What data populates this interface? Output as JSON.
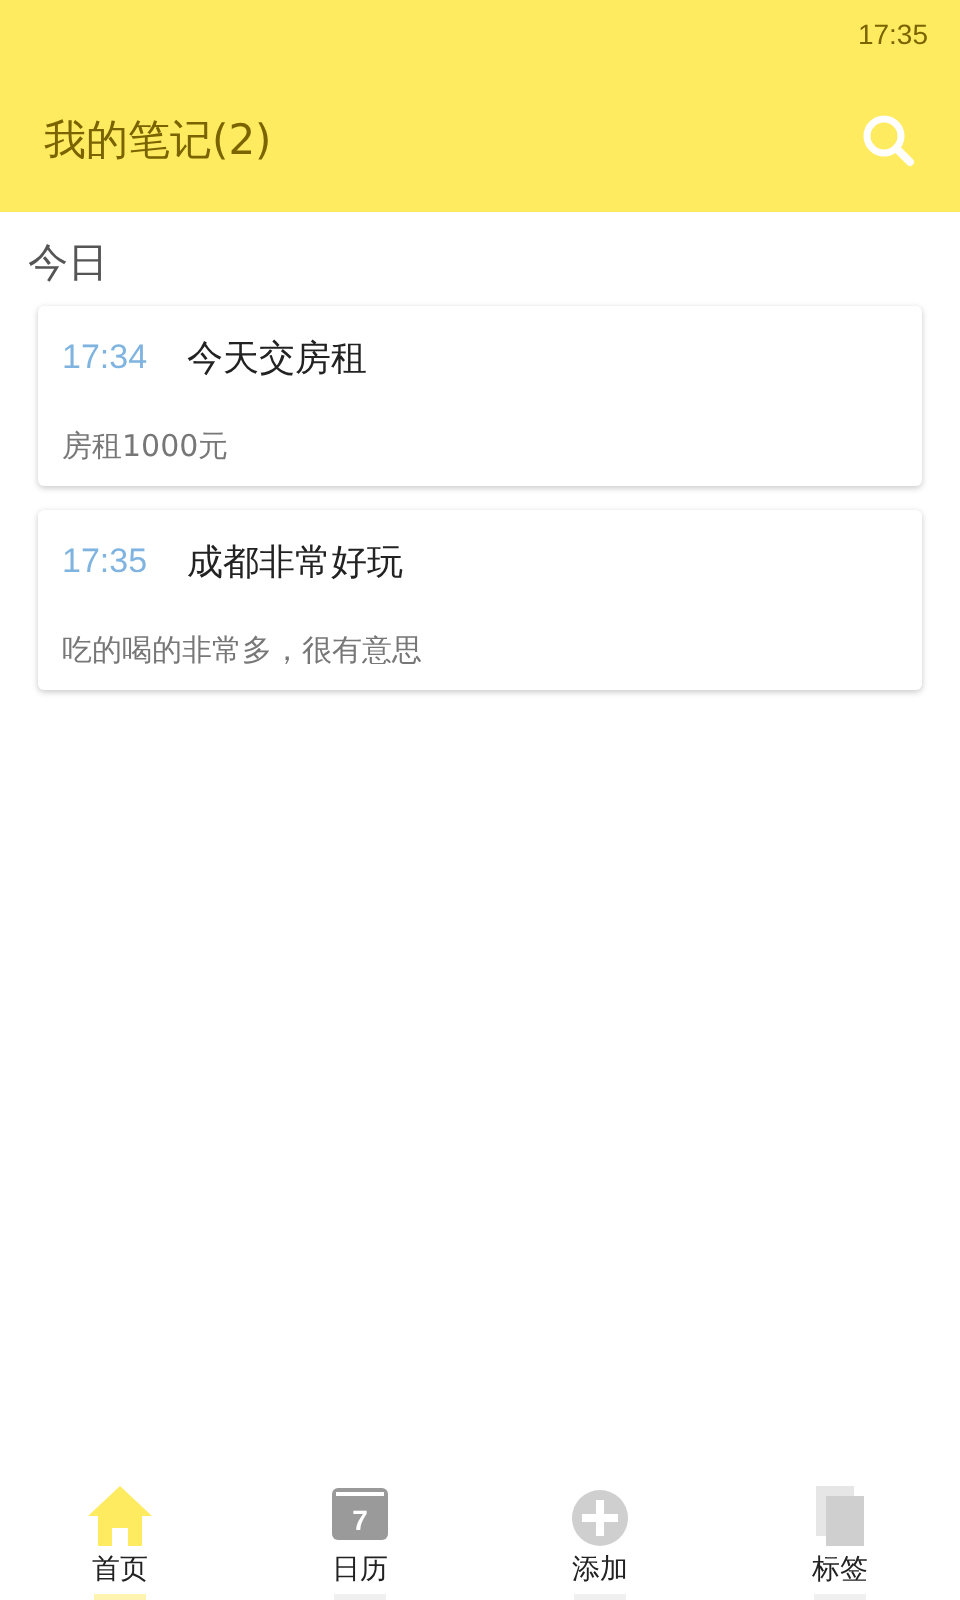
{
  "status_bar": {
    "time": "17:35"
  },
  "header": {
    "title": "我的笔记(2)"
  },
  "section": {
    "title": "今日"
  },
  "notes": [
    {
      "time": "17:34",
      "title": "今天交房租",
      "body": "房租1000元"
    },
    {
      "time": "17:35",
      "title": "成都非常好玩",
      "body": "吃的喝的非常多，很有意思"
    }
  ],
  "tabs": [
    {
      "kind": "home",
      "label": "首页",
      "selected": true
    },
    {
      "kind": "calendar",
      "label": "日历",
      "day": "7",
      "selected": false
    },
    {
      "kind": "add",
      "label": "添加",
      "selected": false
    },
    {
      "kind": "tags",
      "label": "标签",
      "selected": false
    }
  ]
}
